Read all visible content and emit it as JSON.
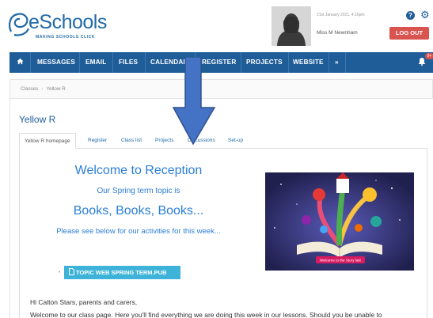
{
  "header": {
    "logo_text": "eSchools",
    "logo_tagline": "MAKING SCHOOLS CLICK",
    "date": "21st January 2021, 4:16pm",
    "username": "Miss M Newnham",
    "logout_label": "LOG OUT",
    "help_icon": "question-icon",
    "settings_icon": "gear-icon"
  },
  "nav": {
    "home_icon": "home-icon",
    "items": [
      "MESSAGES",
      "EMAIL",
      "FILES",
      "CALENDAR",
      "REGISTER",
      "PROJECTS",
      "WEBSITE",
      "»"
    ],
    "notification_count": "9+"
  },
  "breadcrumb": {
    "items": [
      "Classes",
      "Yellow R"
    ]
  },
  "page_title": "Yellow R",
  "tabs": [
    "Yellow R homepage",
    "Register",
    "Class list",
    "Projects",
    "Discussions",
    "Set-up"
  ],
  "content": {
    "welcome": "Welcome to Reception",
    "topic_intro": "Our Spring term topic is",
    "topic": "Books, Books, Books...",
    "see_below": "Please see below for our activities for this week...",
    "file_button": "TOPIC WEB SPRING TERM.PUB",
    "picture_caption": "Welcome to the Story lab!",
    "greeting": "Hi Calton Stars, parents and carers,",
    "intro": "Welcome to our class page. Here you'll find everything we are doing this week in our lessons. Should you be unable to"
  },
  "colors": {
    "brand_blue": "#1f5d99",
    "link_blue": "#2b7ed6",
    "logout_red": "#d9534f",
    "file_button": "#3eb3d9",
    "overlay_arrow": "#4472c4"
  }
}
